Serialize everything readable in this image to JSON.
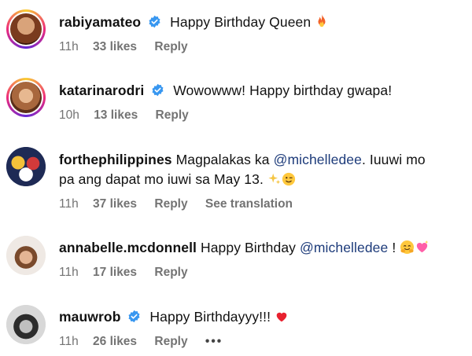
{
  "comments": [
    {
      "user": "rabiyamateo",
      "text": "Happy Birthday Queen",
      "time": "11h",
      "likes": "33 likes",
      "reply": "Reply"
    },
    {
      "user": "katarinarodri",
      "text": "Wowowww! Happy birthday gwapa!",
      "time": "10h",
      "likes": "13 likes",
      "reply": "Reply"
    },
    {
      "user": "forthephilippines",
      "text_before": "Magpalakas ka",
      "mention": "@michelledee",
      "text_after": ". Iuuwi mo",
      "line2": "pa ang dapat mo iuwi sa May 13.",
      "time": "11h",
      "likes": "37 likes",
      "reply": "Reply",
      "see_translation": "See translation"
    },
    {
      "user": "annabelle.mcdonnell",
      "text_before": "Happy Birthday",
      "mention": "@michelledee",
      "text_after": "!",
      "time": "11h",
      "likes": "17 likes",
      "reply": "Reply"
    },
    {
      "user": "mauwrob",
      "text": "Happy Birthdayyy!!!",
      "time": "11h",
      "likes": "26 likes",
      "reply": "Reply",
      "more": "•••"
    }
  ],
  "colors": {
    "verified": "#3897f0",
    "meta": "#737373",
    "mention": "#1d3b7a"
  }
}
